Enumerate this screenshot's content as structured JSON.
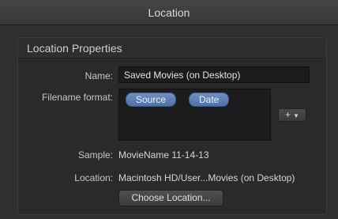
{
  "window": {
    "title": "Location"
  },
  "panel": {
    "title": "Location Properties",
    "name": {
      "label": "Name:",
      "value": "Saved Movies (on Desktop)"
    },
    "filename_format": {
      "label": "Filename format:",
      "tokens": [
        "Source",
        "Date"
      ],
      "add_button": "+",
      "add_button_icon": "chevron-down-icon"
    },
    "sample": {
      "label": "Sample:",
      "value": "MovieName 11-14-13"
    },
    "location": {
      "label": "Location:",
      "value": "Macintosh HD/User...Movies (on Desktop)"
    },
    "choose_button": "Choose Location..."
  }
}
